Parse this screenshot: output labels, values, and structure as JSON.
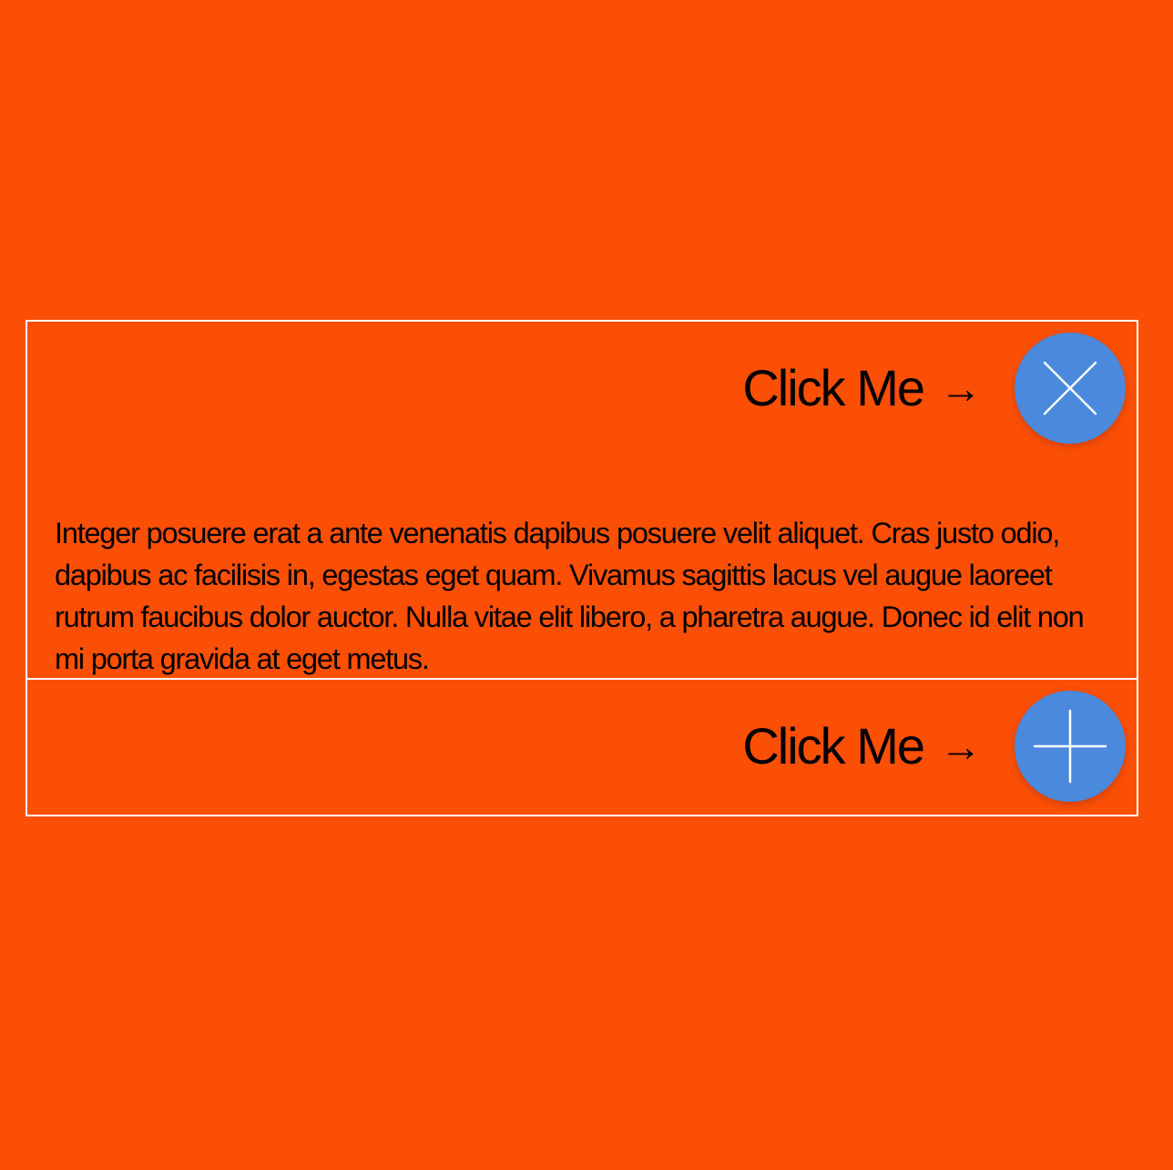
{
  "colors": {
    "background": "#fb4f06",
    "border": "#ffffff",
    "button": "#4a89dc",
    "icon": "#ffffff",
    "text": "#000000"
  },
  "accordion": {
    "panels": [
      {
        "label": "Click Me",
        "arrow": "→",
        "state": "expanded",
        "toggle_icon": "close-icon",
        "content": "Integer posuere erat a ante venenatis dapibus posuere velit aliquet. Cras justo odio, dapibus ac facilisis in, egestas eget quam. Vivamus sagittis lacus vel augue laoreet rutrum faucibus dolor auctor. Nulla vitae elit libero, a pharetra augue. Donec id elit non mi porta gravida at eget metus."
      },
      {
        "label": "Click Me",
        "arrow": "→",
        "state": "collapsed",
        "toggle_icon": "plus-icon"
      }
    ]
  }
}
